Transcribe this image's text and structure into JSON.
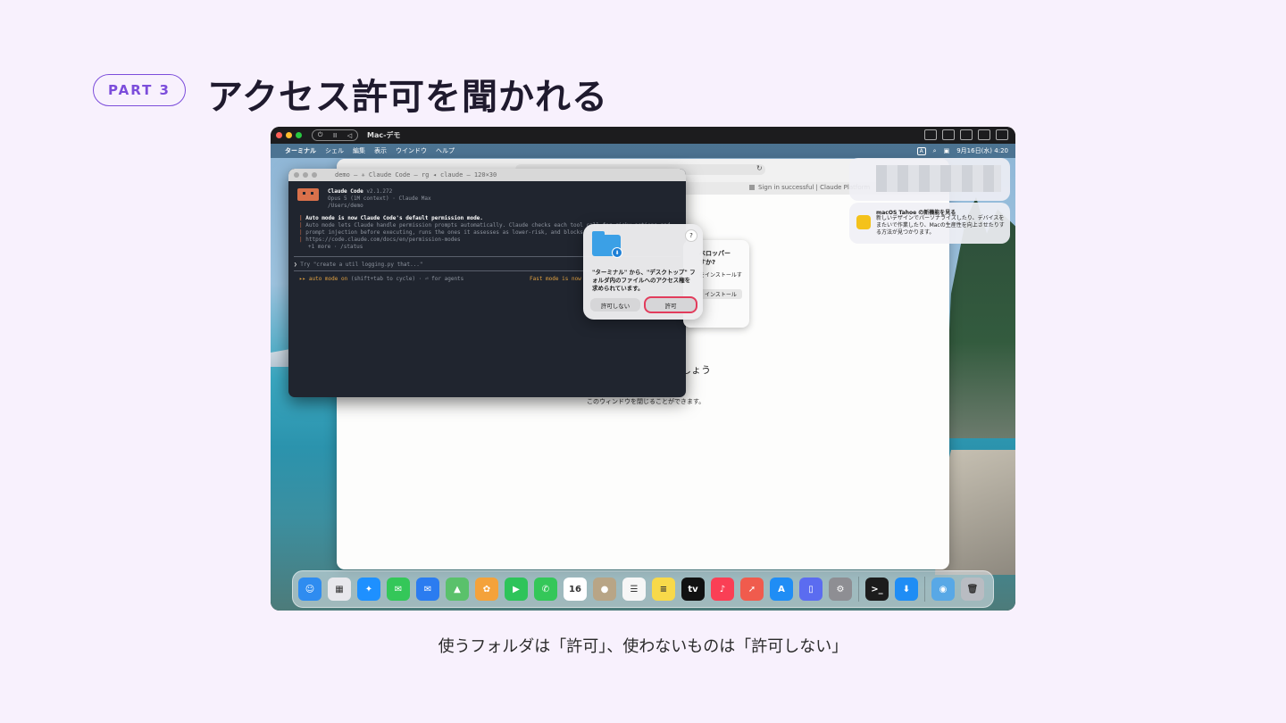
{
  "slide": {
    "part_label": "PART 3",
    "title": "アクセス許可を聞かれる",
    "caption": "使うフォルダは「許可」、使わないものは「許可しない」"
  },
  "vm_window": {
    "title": "Mac-デモ",
    "controls": [
      "⏻",
      "II",
      "◁"
    ]
  },
  "menubar": {
    "apple": "",
    "items": [
      "ターミナル",
      "シェル",
      "編集",
      "表示",
      "ウインドウ",
      "ヘルプ"
    ],
    "input_indicator": "A",
    "search": "⌕",
    "datetime": "9月16日(水) 4:20"
  },
  "browser": {
    "reload": "↻",
    "tab_text": "Sign in successful | Claude Platform",
    "body_text_1": "しょう",
    "body_text_2": "このウィンドウを閉じることができます。"
  },
  "terminal": {
    "title": "demo — ✳ Claude Code — rg ◂ claude — 120×30",
    "app_name": "Claude Code",
    "version": "v2.1.272",
    "model": "Opus 5 (1M context) · Claude Max",
    "path": "/Users/demo",
    "notice_title": "Auto mode is now Claude Code's default permission mode.",
    "notice_line_1": "Auto mode lets Claude handle permission prompts automatically. Claude checks each tool call for risky actions and",
    "notice_line_2": "prompt injection before executing, runs the ones it assesses as lower-risk, and blocks the rest.",
    "notice_line_3": "https://code.claude.com/docs/en/permission-modes",
    "more": "+1 more · /status",
    "prompt_symbol": "❯",
    "prompt_placeholder": "Try \"create a util logging.py that...\"",
    "mode_arrows": "▸▸",
    "mode_label": "auto mode on",
    "mode_hint": "(shift+tab to cycle) · ⏎ for agents",
    "fast_mode": "Fast mode is now"
  },
  "installer_dialog": {
    "line_1": "ベロッパー",
    "line_2": "すか?",
    "line_3": "をインストールす",
    "button": "インストール"
  },
  "permission_dialog": {
    "help": "?",
    "badge": "⬇",
    "message": "\"ターミナル\" から、\"デスクトップ\" フォルダ内のファイルへのアクセス権を求められています。",
    "deny_label": "許可しない",
    "allow_label": "許可"
  },
  "notification": {
    "title": "macOS Tahoe の新機能を見る",
    "body": "新しいデザインでパーソナライズしたり、デバイスをまたいで作業したり、Macの生産性を向上させたりする方法が見つかります。"
  },
  "dock": {
    "apps": [
      {
        "name": "finder",
        "color": "#2f8cf0",
        "glyph": "☺"
      },
      {
        "name": "launchpad",
        "color": "#e8e8ec",
        "glyph": "▦"
      },
      {
        "name": "safari",
        "color": "#1e90ff",
        "glyph": "✦"
      },
      {
        "name": "messages",
        "color": "#34c759",
        "glyph": "✉"
      },
      {
        "name": "mail",
        "color": "#2b7cf0",
        "glyph": "✉"
      },
      {
        "name": "maps",
        "color": "#5ac16b",
        "glyph": "▲"
      },
      {
        "name": "photos",
        "color": "#f4a23a",
        "glyph": "✿"
      },
      {
        "name": "facetime",
        "color": "#2ec45a",
        "glyph": "▶"
      },
      {
        "name": "phone",
        "color": "#34c759",
        "glyph": "✆"
      },
      {
        "name": "calendar",
        "color": "#ffffff",
        "glyph": "16"
      },
      {
        "name": "contacts",
        "color": "#b8a586",
        "glyph": "●"
      },
      {
        "name": "reminders",
        "color": "#f6f6f6",
        "glyph": "☰"
      },
      {
        "name": "notes",
        "color": "#f8d94a",
        "glyph": "≡"
      },
      {
        "name": "tv",
        "color": "#111111",
        "glyph": "tv"
      },
      {
        "name": "music",
        "color": "#fa3f55",
        "glyph": "♪"
      },
      {
        "name": "launcher",
        "color": "#f05b4d",
        "glyph": "➚"
      },
      {
        "name": "app-store",
        "color": "#1f8df5",
        "glyph": "A"
      },
      {
        "name": "iphone-mirroring",
        "color": "#5b6cf0",
        "glyph": "▯"
      },
      {
        "name": "system-settings",
        "color": "#8e8e93",
        "glyph": "⚙"
      }
    ],
    "recent": [
      {
        "name": "terminal",
        "color": "#1c1c1c",
        "glyph": ">_"
      },
      {
        "name": "downloads-app",
        "color": "#1f8df5",
        "glyph": "⬇"
      }
    ],
    "trailing": [
      {
        "name": "downloads-folder",
        "color": "#58a8e6",
        "glyph": "◉"
      },
      {
        "name": "trash",
        "color": "#b9bcc2",
        "glyph": "🗑"
      }
    ]
  }
}
